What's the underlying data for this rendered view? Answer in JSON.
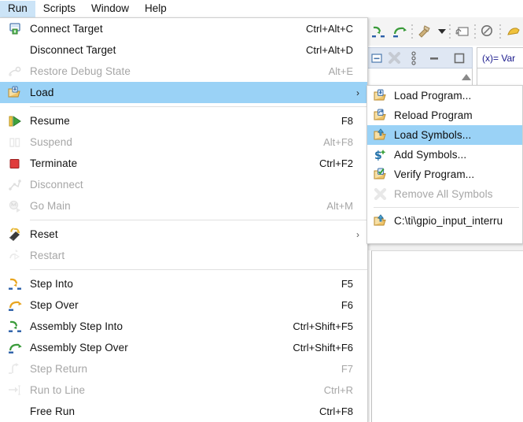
{
  "menubar": {
    "items": [
      {
        "label": "Run",
        "active": true
      },
      {
        "label": "Scripts",
        "active": false
      },
      {
        "label": "Window",
        "active": false
      },
      {
        "label": "Help",
        "active": false
      }
    ]
  },
  "toolbar": {
    "buttons": [
      {
        "name": "assembly-step-into-icon"
      },
      {
        "name": "assembly-step-over-icon"
      },
      {
        "name": "build-hammer-icon"
      },
      {
        "name": "build-dropdown-arrow-icon"
      },
      {
        "name": "debug-launch-icon"
      },
      {
        "name": "search-icon"
      },
      {
        "name": "connect-target-icon"
      }
    ]
  },
  "view_panel": {
    "collapse_label": "",
    "variables_tab_label": "(x)= Var",
    "buttons": [
      "minimize-icon",
      "disconnect-icon",
      "view-menu-icon",
      "minimize-window-icon",
      "maximize-window-icon"
    ]
  },
  "run_menu": {
    "items": [
      {
        "label": "Connect Target",
        "accel": "Ctrl+Alt+C",
        "icon": "connect-target-icon",
        "disabled": false,
        "selected": false,
        "submenu": false
      },
      {
        "label": "Disconnect Target",
        "accel": "Ctrl+Alt+D",
        "icon": "none",
        "disabled": false,
        "selected": false,
        "submenu": false
      },
      {
        "label": "Restore Debug State",
        "accel": "Alt+E",
        "icon": "restore-debug-state-icon",
        "disabled": true,
        "selected": false,
        "submenu": false
      },
      {
        "label": "Load",
        "accel": "",
        "icon": "load-folder-icon",
        "disabled": false,
        "selected": true,
        "submenu": true
      },
      {
        "separator": true
      },
      {
        "label": "Resume",
        "accel": "F8",
        "icon": "resume-icon",
        "disabled": false,
        "selected": false,
        "submenu": false
      },
      {
        "label": "Suspend",
        "accel": "Alt+F8",
        "icon": "suspend-icon",
        "disabled": true,
        "selected": false,
        "submenu": false
      },
      {
        "label": "Terminate",
        "accel": "Ctrl+F2",
        "icon": "terminate-icon",
        "disabled": false,
        "selected": false,
        "submenu": false
      },
      {
        "label": "Disconnect",
        "accel": "",
        "icon": "disconnect-icon",
        "disabled": true,
        "selected": false,
        "submenu": false
      },
      {
        "label": "Go Main",
        "accel": "Alt+M",
        "icon": "go-main-icon",
        "disabled": true,
        "selected": false,
        "submenu": false
      },
      {
        "separator": true
      },
      {
        "label": "Reset",
        "accel": "",
        "icon": "reset-chip-icon",
        "disabled": false,
        "selected": false,
        "submenu": true
      },
      {
        "label": "Restart",
        "accel": "",
        "icon": "restart-icon",
        "disabled": true,
        "selected": false,
        "submenu": false
      },
      {
        "separator": true
      },
      {
        "label": "Step Into",
        "accel": "F5",
        "icon": "step-into-icon",
        "disabled": false,
        "selected": false,
        "submenu": false
      },
      {
        "label": "Step Over",
        "accel": "F6",
        "icon": "step-over-icon",
        "disabled": false,
        "selected": false,
        "submenu": false
      },
      {
        "label": "Assembly Step Into",
        "accel": "Ctrl+Shift+F5",
        "icon": "assembly-step-into-icon",
        "disabled": false,
        "selected": false,
        "submenu": false
      },
      {
        "label": "Assembly Step Over",
        "accel": "Ctrl+Shift+F6",
        "icon": "assembly-step-over-icon",
        "disabled": false,
        "selected": false,
        "submenu": false
      },
      {
        "label": "Step Return",
        "accel": "F7",
        "icon": "step-return-icon",
        "disabled": true,
        "selected": false,
        "submenu": false
      },
      {
        "label": "Run to Line",
        "accel": "Ctrl+R",
        "icon": "run-to-line-icon",
        "disabled": true,
        "selected": false,
        "submenu": false
      },
      {
        "label": "Free Run",
        "accel": "Ctrl+F8",
        "icon": "none",
        "disabled": false,
        "selected": false,
        "submenu": false
      }
    ]
  },
  "load_submenu": {
    "items": [
      {
        "label": "Load Program...",
        "icon": "load-program-icon",
        "disabled": false,
        "selected": false
      },
      {
        "label": "Reload Program",
        "icon": "reload-program-icon",
        "disabled": false,
        "selected": false
      },
      {
        "label": "Load Symbols...",
        "icon": "load-symbols-icon",
        "disabled": false,
        "selected": true
      },
      {
        "label": "Add Symbols...",
        "icon": "add-symbols-icon",
        "disabled": false,
        "selected": false
      },
      {
        "label": "Verify Program...",
        "icon": "verify-program-icon",
        "disabled": false,
        "selected": false
      },
      {
        "label": "Remove All Symbols",
        "icon": "remove-symbols-icon",
        "disabled": true,
        "selected": false
      },
      {
        "separator": true
      },
      {
        "label": "C:\\ti\\gpio_input_interru",
        "icon": "load-symbols-icon",
        "disabled": false,
        "selected": false
      }
    ]
  },
  "colors": {
    "selection": "#9ad2f6",
    "menubar_active": "#cce4f7",
    "menu_bg": "#ffffff",
    "disabled_text": "#a6a6a6",
    "text": "#121212"
  }
}
